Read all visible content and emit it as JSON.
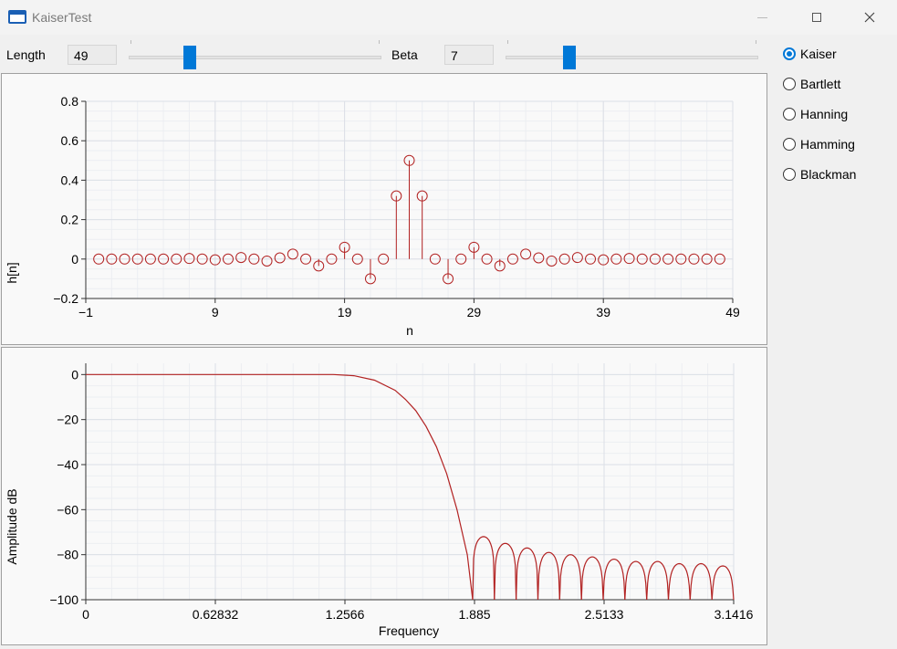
{
  "window": {
    "title": "KaiserTest"
  },
  "controls": {
    "length_label": "Length",
    "length_value": "49",
    "length_slider_fraction": 0.23,
    "beta_label": "Beta",
    "beta_value": "7",
    "beta_slider_fraction": 0.24
  },
  "window_types": {
    "options": [
      "Kaiser",
      "Bartlett",
      "Hanning",
      "Hamming",
      "Blackman"
    ],
    "selected": "Kaiser"
  },
  "colors": {
    "series": "#b22222",
    "accent": "#0078d7",
    "grid": "#dcdfe6"
  },
  "chart_data": [
    {
      "type": "scatter",
      "style": "stem",
      "title": "",
      "xlabel": "n",
      "ylabel": "h[n]",
      "xlim": [
        -1,
        49
      ],
      "ylim": [
        -0.2,
        0.8
      ],
      "xticks": [
        "-1",
        "9",
        "19",
        "29",
        "39",
        "49"
      ],
      "yticks": [
        "-0.2",
        "0",
        "0.2",
        "0.4",
        "0.6",
        "0.8"
      ],
      "grid": true,
      "x": [
        0,
        1,
        2,
        3,
        4,
        5,
        6,
        7,
        8,
        9,
        10,
        11,
        12,
        13,
        14,
        15,
        16,
        17,
        18,
        19,
        20,
        21,
        22,
        23,
        24,
        25,
        26,
        27,
        28,
        29,
        30,
        31,
        32,
        33,
        34,
        35,
        36,
        37,
        38,
        39,
        40,
        41,
        42,
        43,
        44,
        45,
        46,
        47,
        48
      ],
      "values": [
        0,
        0,
        0,
        0,
        0,
        0,
        0,
        0.003,
        0,
        -0.004,
        0,
        0.008,
        0,
        -0.01,
        0.006,
        0.025,
        0,
        -0.035,
        0,
        0.06,
        0,
        -0.1,
        0,
        0.32,
        0.5,
        0.32,
        0,
        -0.1,
        0,
        0.06,
        0,
        -0.035,
        0,
        0.025,
        0.006,
        -0.01,
        0,
        0.008,
        0,
        -0.004,
        0,
        0.003,
        0,
        0,
        0,
        0,
        0,
        0,
        0
      ]
    },
    {
      "type": "line",
      "title": "",
      "xlabel": "Frequency",
      "ylabel": "Amplitude dB",
      "xlim": [
        0,
        3.1416
      ],
      "ylim": [
        -100,
        5
      ],
      "xticks": [
        "0",
        "0.62832",
        "1.2566",
        "1.885",
        "2.5133",
        "3.1416"
      ],
      "yticks": [
        "-100",
        "-80",
        "-60",
        "-40",
        "-20",
        "0"
      ],
      "grid": true,
      "series": [
        {
          "x": [
            0,
            0.3,
            0.6,
            0.9,
            1.2,
            1.3,
            1.4,
            1.5,
            1.55,
            1.6,
            1.65,
            1.7,
            1.75,
            1.8,
            1.85,
            1.876
          ],
          "values": [
            0,
            0,
            0,
            0,
            0,
            -0.5,
            -2.5,
            -7,
            -11,
            -16,
            -23,
            -32,
            -44,
            -60,
            -80,
            -100
          ]
        }
      ],
      "sidelobe_region": {
        "start": 1.876,
        "end": 3.1416,
        "lobe_count": 12,
        "peaks": [
          -72,
          -75,
          -77,
          -79,
          -80,
          -81,
          -82,
          -83,
          -83,
          -84,
          -84,
          -85
        ]
      }
    }
  ]
}
